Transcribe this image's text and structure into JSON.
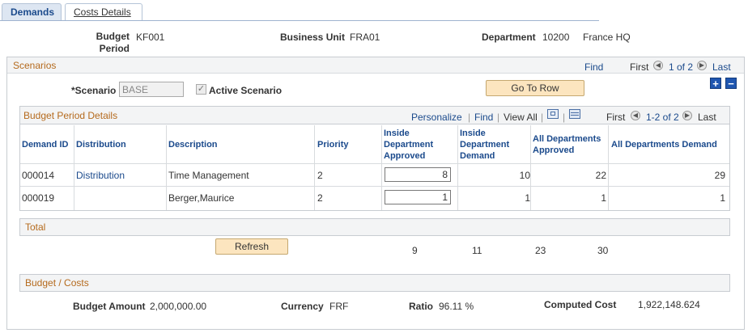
{
  "tabs": [
    {
      "label": "Demands"
    },
    {
      "label": "Costs Details"
    }
  ],
  "header": {
    "budget_period_label_1": "Budget",
    "budget_period_label_2": "Period",
    "budget_period_value": "KF001",
    "business_unit_label": "Business Unit",
    "business_unit_value": "FRA01",
    "department_label": "Department",
    "department_value": "10200",
    "department_desc": "France HQ"
  },
  "scenarios": {
    "title": "Scenarios",
    "find": "Find",
    "first": "First",
    "count": "1 of 2",
    "last": "Last",
    "scenario_label": "*Scenario",
    "scenario_value": "BASE",
    "active_label": "Active Scenario",
    "go_to_row": "Go To Row"
  },
  "details": {
    "title": "Budget Period Details",
    "personalize": "Personalize",
    "find": "Find",
    "view_all": "View All",
    "first": "First",
    "count": "1-2 of 2",
    "last": "Last",
    "columns": {
      "demand_id": "Demand ID",
      "distribution": "Distribution",
      "description": "Description",
      "priority": "Priority",
      "inside_approved_1": "Inside",
      "inside_approved_2": "Department",
      "inside_approved_3": "Approved",
      "inside_demand_1": "Inside",
      "inside_demand_2": "Department",
      "inside_demand_3": "Demand",
      "all_approved_1": "All Departments",
      "all_approved_2": "Approved",
      "all_demand": "All Departments Demand"
    },
    "rows": [
      {
        "demand_id": "000014",
        "distribution": "Distribution",
        "description": "Time Management",
        "priority": "2",
        "inside_approved": "8",
        "inside_demand": "10",
        "all_approved": "22",
        "all_demand": "29"
      },
      {
        "demand_id": "000019",
        "distribution": "",
        "description": "Berger,Maurice",
        "priority": "2",
        "inside_approved": "1",
        "inside_demand": "1",
        "all_approved": "1",
        "all_demand": "1"
      }
    ]
  },
  "total": {
    "title": "Total",
    "refresh": "Refresh",
    "inside_approved": "9",
    "inside_demand": "11",
    "all_approved": "23",
    "all_demand": "30"
  },
  "budget_costs": {
    "title": "Budget / Costs",
    "budget_amount_label": "Budget Amount",
    "budget_amount_value": "2,000,000.00",
    "currency_label": "Currency",
    "currency_value": "FRF",
    "ratio_label": "Ratio",
    "ratio_value": "96.11 %",
    "computed_cost_label": "Computed Cost",
    "computed_cost_value": "1,922,148.624"
  }
}
